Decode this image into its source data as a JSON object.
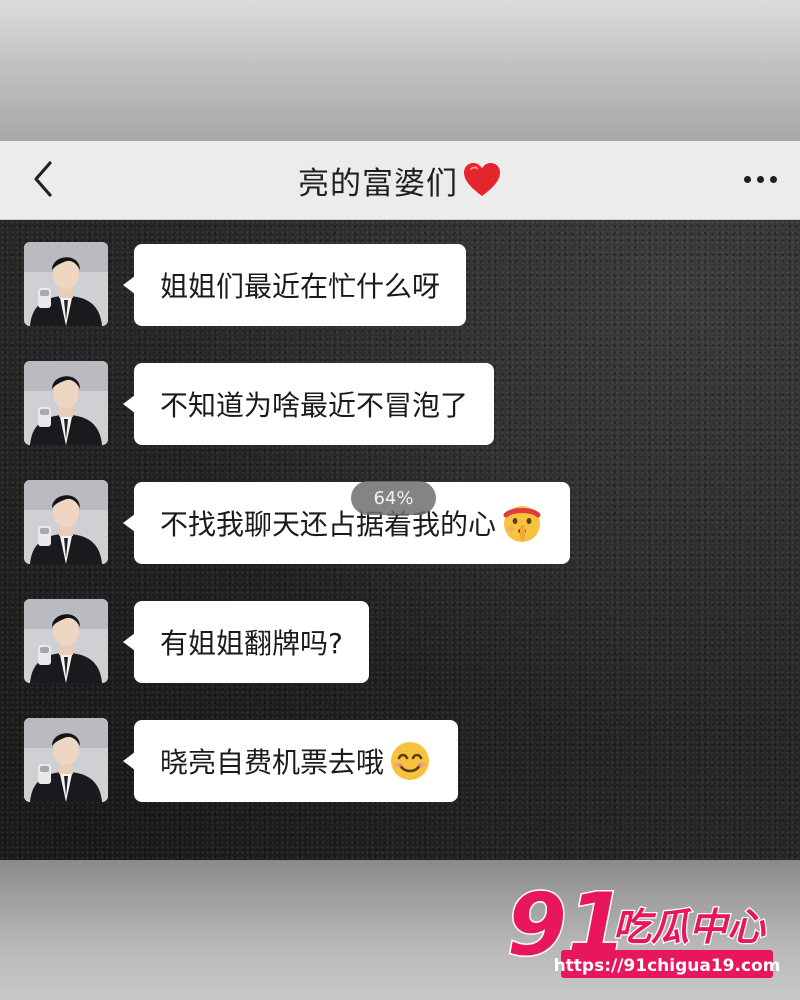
{
  "header": {
    "title": "亮的富婆们",
    "title_emoji": "red-heart-icon",
    "back_icon": "chevron-left-icon",
    "more_icon": "more-dots-icon"
  },
  "messages": [
    {
      "text": "姐姐们最近在忙什么呀",
      "emoji": ""
    },
    {
      "text": "不知道为啥最近不冒泡了",
      "emoji": ""
    },
    {
      "text": "不找我聊天还占据着我的心",
      "emoji": "shushing-face-icon"
    },
    {
      "text": "有姐姐翻牌吗?",
      "emoji": ""
    },
    {
      "text": "晓亮自费机票去哦",
      "emoji": "smiling-face-icon"
    }
  ],
  "overlay": {
    "progress": "64%"
  },
  "watermark": {
    "number": "91",
    "name": "吃瓜中心",
    "url": "https://91chigua19.com"
  },
  "colors": {
    "bubble": "#ffffff",
    "nav_bg": "#ececec",
    "watermark_pink": "#e8175d"
  }
}
